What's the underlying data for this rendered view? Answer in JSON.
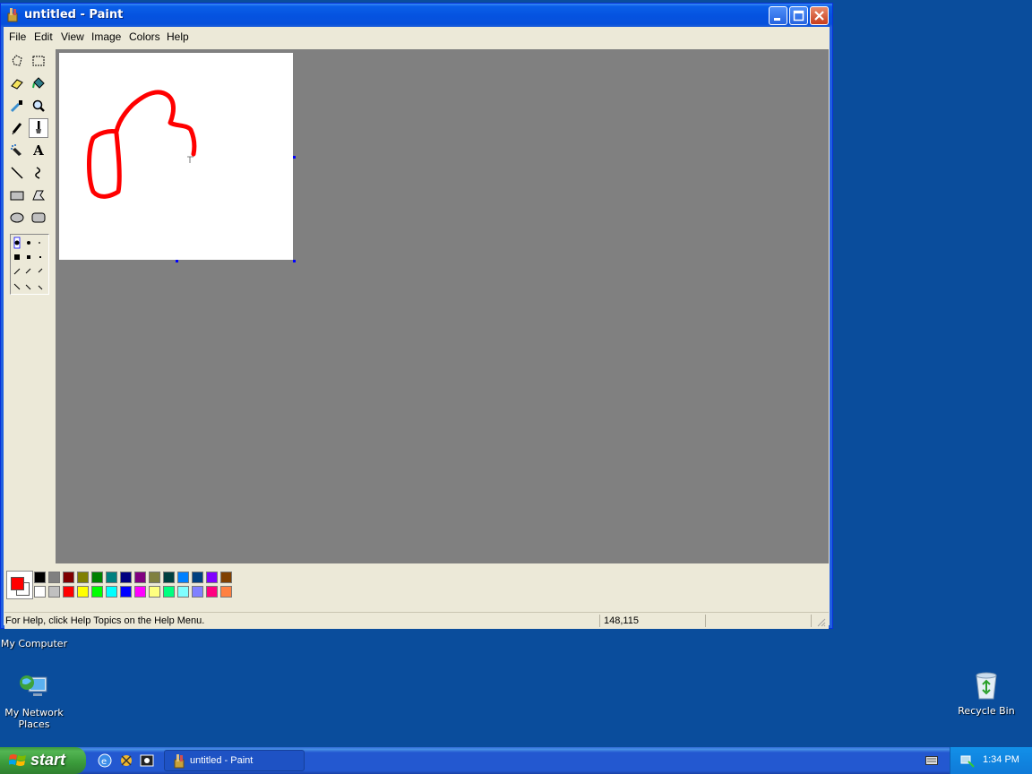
{
  "window": {
    "title": "untitled - Paint",
    "menu": [
      "File",
      "Edit",
      "View",
      "Image",
      "Colors",
      "Help"
    ]
  },
  "toolbox": {
    "tools": [
      "free-form-select-icon",
      "select-icon",
      "eraser-icon",
      "fill-icon",
      "pick-color-icon",
      "magnifier-icon",
      "pencil-icon",
      "brush-icon",
      "airbrush-icon",
      "text-icon",
      "line-icon",
      "curve-icon",
      "rectangle-icon",
      "polygon-icon",
      "ellipse-icon",
      "rounded-rectangle-icon"
    ],
    "selected_tool": "brush-icon",
    "text_tool_glyph": "A"
  },
  "colors": {
    "primary": "#ff0000",
    "secondary": "#ffffff",
    "palette_top": [
      "#000000",
      "#808080",
      "#800000",
      "#808000",
      "#008000",
      "#008080",
      "#000080",
      "#800080",
      "#808040",
      "#004040",
      "#0080ff",
      "#004080",
      "#8000ff",
      "#804000"
    ],
    "palette_bottom": [
      "#ffffff",
      "#c0c0c0",
      "#ff0000",
      "#ffff00",
      "#00ff00",
      "#00ffff",
      "#0000ff",
      "#ff00ff",
      "#ffff80",
      "#00ff80",
      "#80ffff",
      "#8080ff",
      "#ff0080",
      "#ff8040"
    ]
  },
  "status": {
    "help_text": "For Help, click Help Topics on the Help Menu.",
    "coords": "148,115"
  },
  "desktop": {
    "my_computer": "My Computer",
    "network_places": "My Network Places",
    "recycle_bin": "Recycle Bin"
  },
  "taskbar": {
    "start": "start",
    "task": "untitled - Paint",
    "clock": "1:34 PM"
  }
}
